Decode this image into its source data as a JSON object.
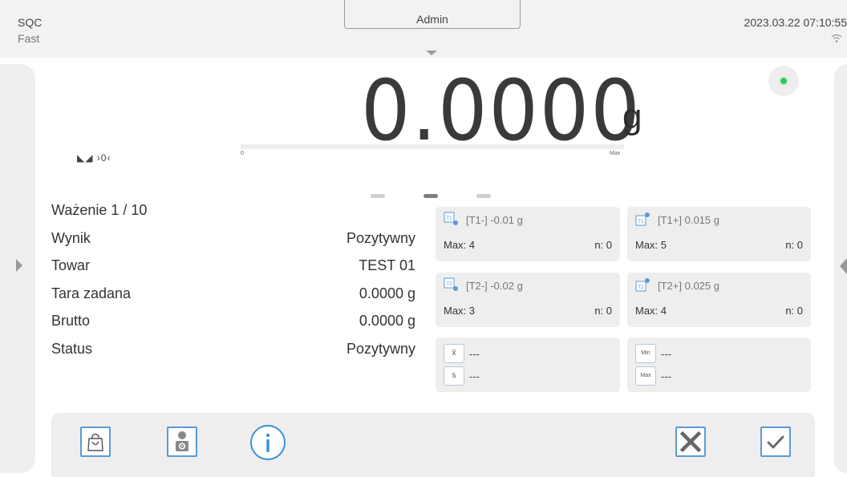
{
  "header": {
    "mode": "SQC",
    "speed": "Fast",
    "user": "Admin",
    "datetime": "2023.03.22 07:10:55"
  },
  "display": {
    "weight": "0.0000",
    "unit": "g",
    "symbols": "◣◢ ›0‹",
    "bargraph_min": "0",
    "bargraph_max": "Max",
    "bargraph_fill_fraction": 0.0,
    "stable_color": "#34c759"
  },
  "info": {
    "rows": [
      {
        "label": "Ważenie 1 / 10",
        "value": ""
      },
      {
        "label": "Wynik",
        "value": "Pozytywny"
      },
      {
        "label": "Towar",
        "value": "TEST 01"
      },
      {
        "label": "Tara zadana",
        "value": "0.0000 g"
      },
      {
        "label": "Brutto",
        "value": "0.0000 g"
      },
      {
        "label": "Status",
        "value": "Pozytywny"
      }
    ]
  },
  "tiles": {
    "t1_minus": {
      "title": "[T1-]  -0.01 g",
      "max": "Max: 4",
      "n": "n: 0"
    },
    "t1_plus": {
      "title": "[T1+]  0.015 g",
      "max": "Max: 5",
      "n": "n: 0"
    },
    "t2_minus": {
      "title": "[T2-]  -0.02 g",
      "max": "Max: 3",
      "n": "n: 0"
    },
    "t2_plus": {
      "title": "[T2+]  0.025 g",
      "max": "Max: 4",
      "n": "n: 0"
    },
    "stats_left": {
      "mean_label": "x̄",
      "mean_value": "---",
      "sd_label": "s",
      "sd_value": "---"
    },
    "stats_right": {
      "min_label": "Min",
      "min_value": "---",
      "max_label": "Max",
      "max_value": "---"
    }
  },
  "icons": {
    "t1": "T1",
    "t2": "T2",
    "toolbar": [
      "shopping-bag-icon",
      "user-settings-icon",
      "info-icon",
      "cancel-icon",
      "confirm-icon"
    ]
  },
  "colors": {
    "accent": "#5a9bd5",
    "tile_bg": "#eeeeee"
  }
}
